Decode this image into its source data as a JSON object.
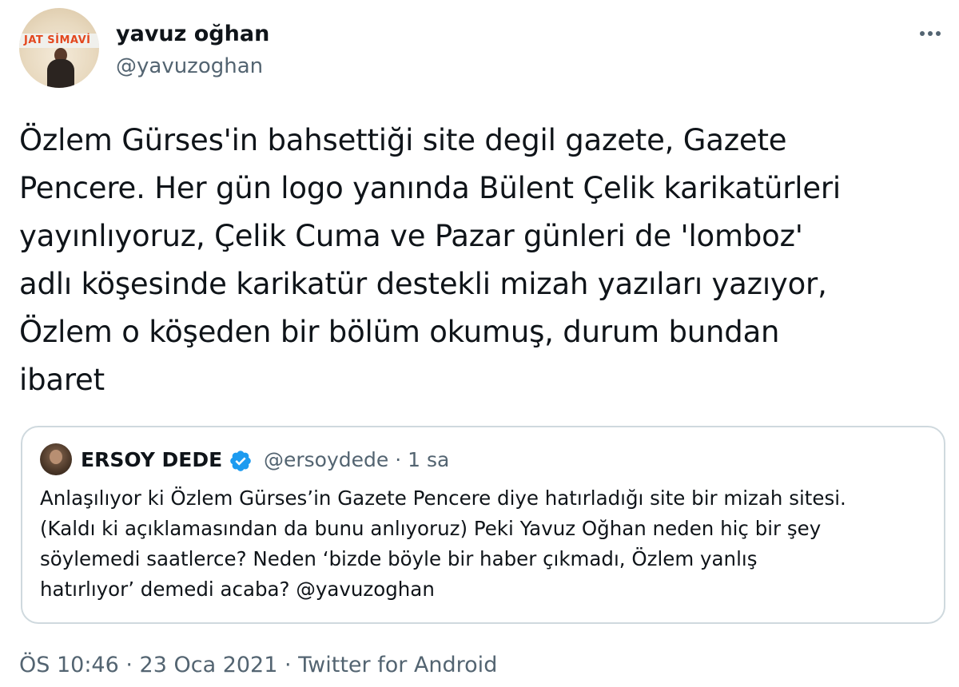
{
  "tweet": {
    "author": {
      "display_name": "yavuz oğhan",
      "handle": "@yavuzoghan",
      "avatar_banner_text": "JAT SİMAVİ"
    },
    "more_icon": "more-horizontal-icon",
    "text": "Özlem Gürses'in bahsettiği site degil gazete, Gazete\nPencere. Her gün logo yanında Bülent Çelik karikatürleri\nyayınlıyoruz, Çelik Cuma ve Pazar günleri de 'lomboz'\nadlı köşesinde karikatür destekli mizah yazıları yazıyor,\nÖzlem o köşeden bir bölüm okumuş, durum bundan\nibaret",
    "quoted": {
      "display_name": "ERSOY DEDE",
      "verified_icon": "verified-badge-icon",
      "meta": "@ersoydede · 1 sa",
      "text": "Anlaşılıyor ki Özlem Gürses’in Gazete Pencere diye hatırladığı site bir mizah sitesi.\n(Kaldı ki açıklamasından da bunu anlıyoruz) Peki Yavuz Oğhan neden hiç bir şey\nsöylemedi saatlerce? Neden ‘bizde böyle bir haber çıkmadı, Özlem yanlış\nhatırlıyor’ demedi acaba? @yavuzoghan"
    },
    "footer": {
      "time_date": "ÖS 10:46 · 23 Oca 2021 · ",
      "source": "Twitter for Android"
    }
  },
  "colors": {
    "text_primary": "#0f1419",
    "text_secondary": "#536471",
    "border": "#cfd9de",
    "verified_blue": "#1d9bf0",
    "banner_red": "#e3481f"
  }
}
